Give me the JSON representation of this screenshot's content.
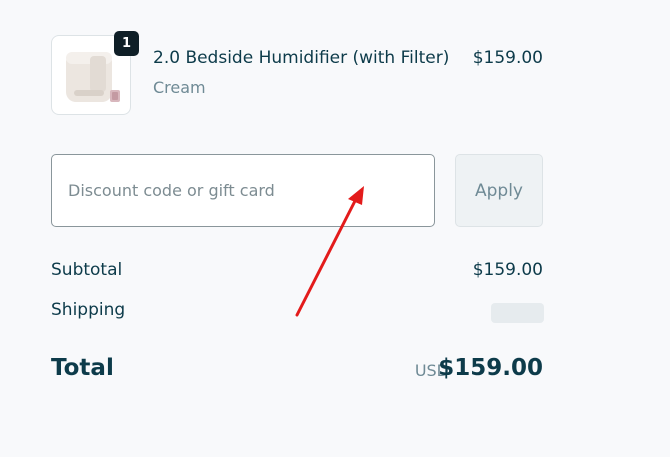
{
  "product": {
    "image_icon": "humidifier-product-image",
    "quantity": "1",
    "name": "2.0 Bedside Humidifier (with Filter)",
    "variant": "Cream",
    "price": "$159.00"
  },
  "discount": {
    "placeholder": "Discount code or gift card",
    "value": "",
    "apply_label": "Apply"
  },
  "summary": {
    "subtotal_label": "Subtotal",
    "subtotal_value": "$159.00",
    "shipping_label": "Shipping",
    "total_label": "Total",
    "total_currency": "USD",
    "total_value": "$159.00"
  },
  "colors": {
    "text_primary": "#0d3b4a",
    "text_muted": "#6f8a95",
    "annotation_arrow": "#e31b1b"
  }
}
